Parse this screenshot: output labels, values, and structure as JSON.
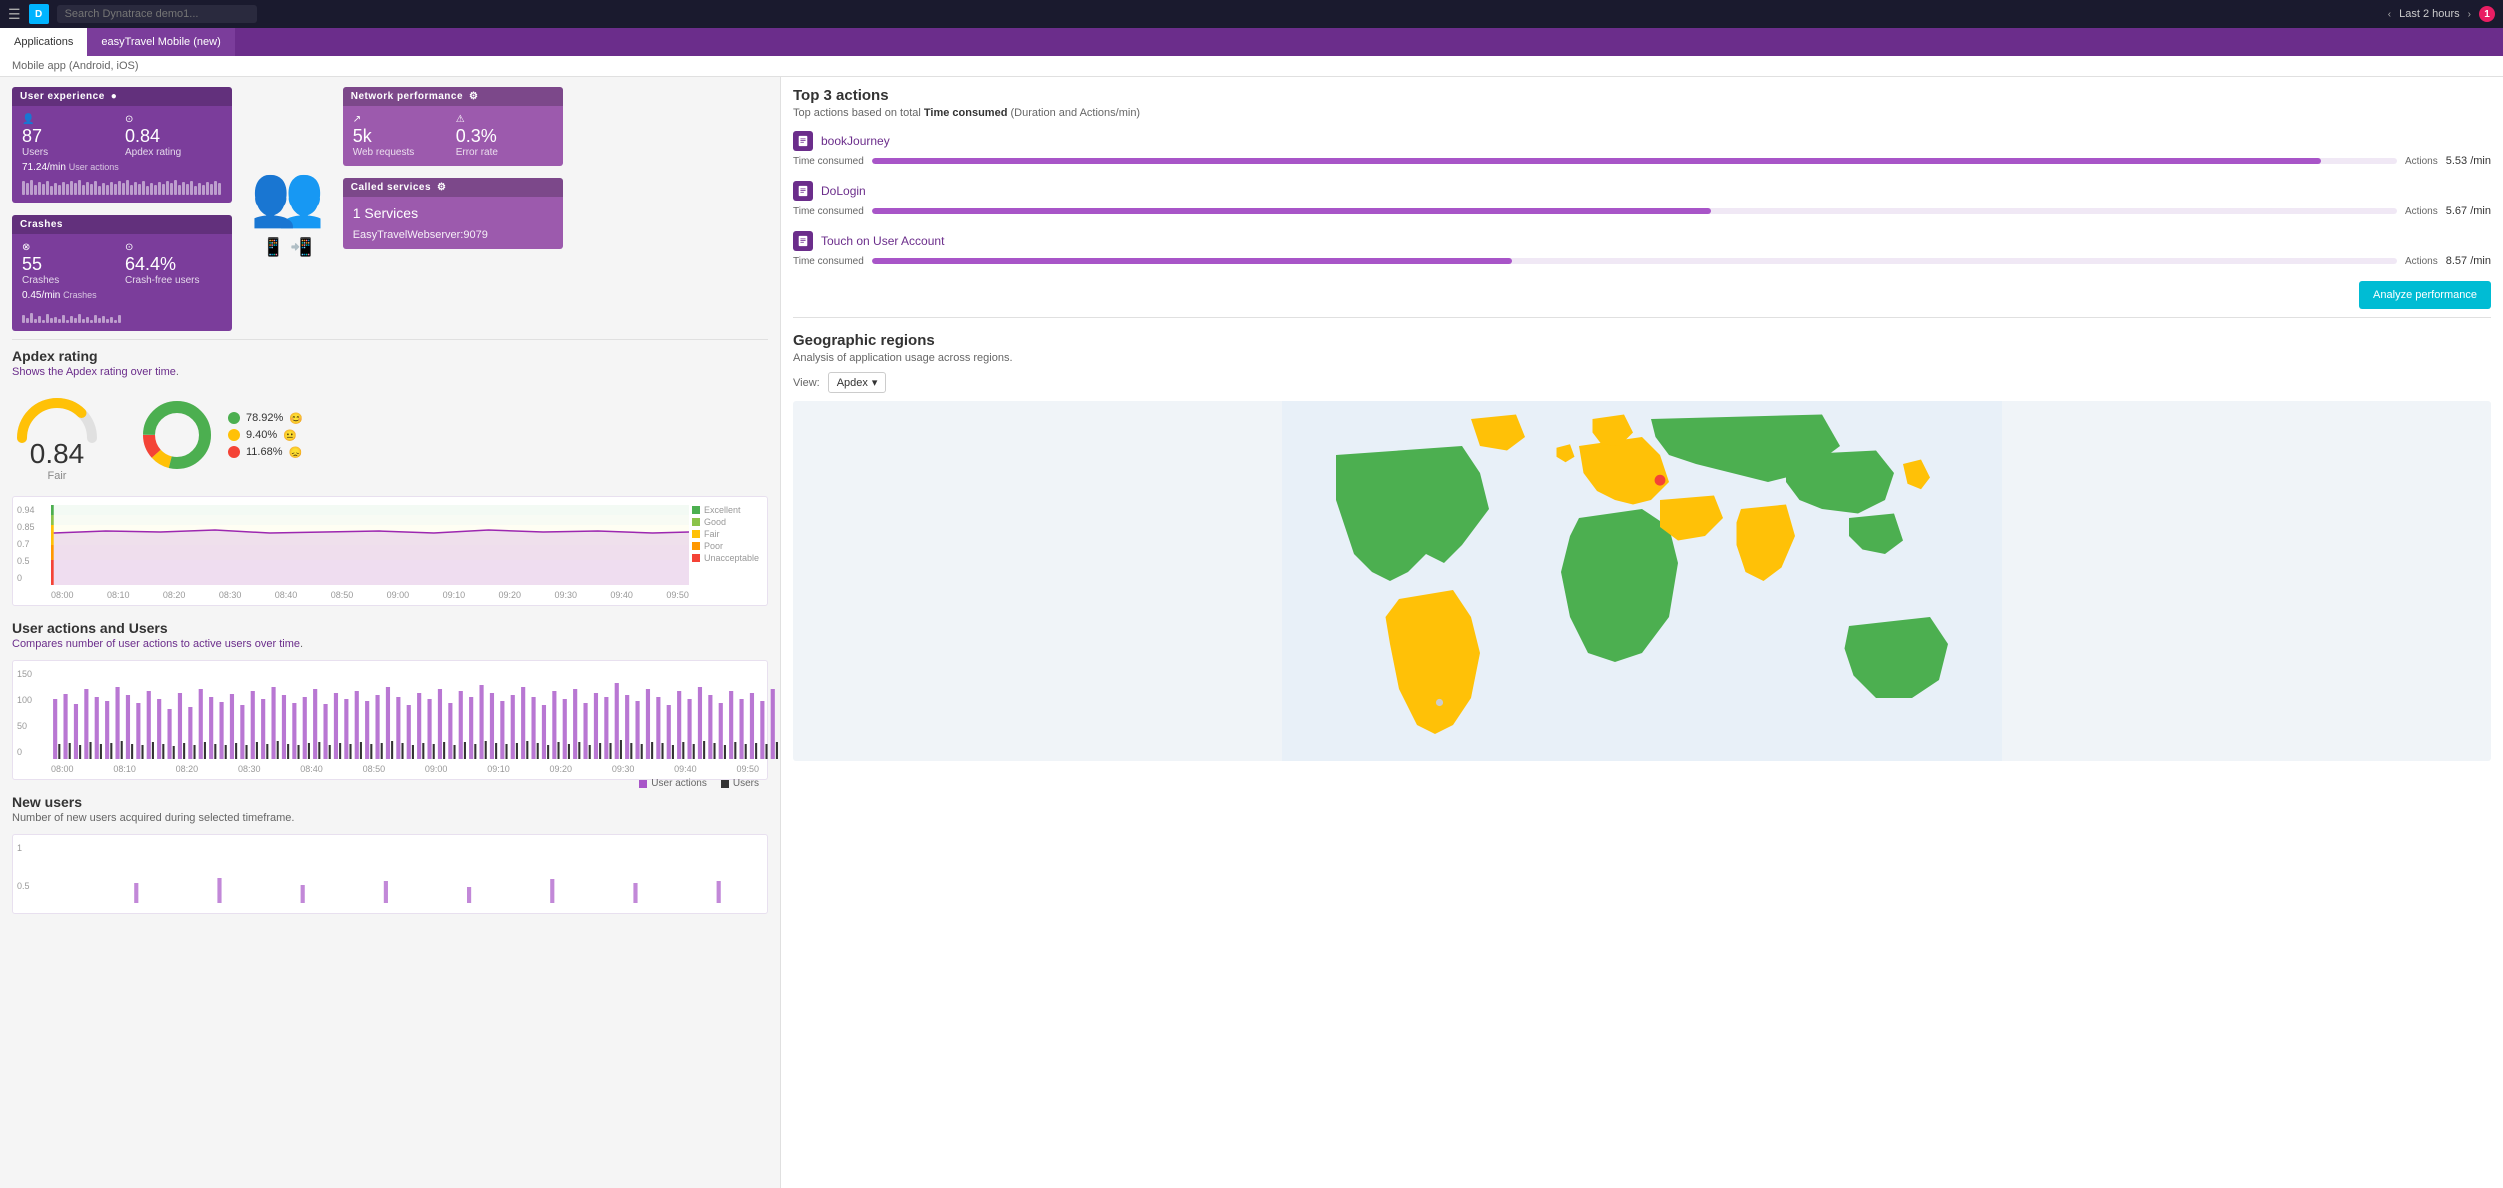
{
  "topnav": {
    "search_placeholder": "Search Dynatrace demo1...",
    "last_hours": "Last 2 hours",
    "notification_count": "1"
  },
  "tabs": [
    {
      "label": "Applications",
      "active": true
    },
    {
      "label": "easyTravel Mobile (new)",
      "active": false
    }
  ],
  "breadcrumb": "Mobile app (Android, iOS)",
  "overview": {
    "user_experience": {
      "title": "User experience",
      "users_value": "87",
      "users_label": "Users",
      "apdex_value": "0.84",
      "apdex_label": "Apdex rating",
      "actions_rate": "71.24/min",
      "actions_label": "User actions"
    },
    "crashes": {
      "title": "Crashes",
      "crashes_value": "55",
      "crashes_label": "Crashes",
      "crash_free_value": "64.4%",
      "crash_free_label": "Crash-free users",
      "crashes_rate": "0.45/min",
      "crashes_rate_label": "Crashes"
    },
    "network": {
      "title": "Network performance",
      "requests_value": "5k",
      "requests_label": "Web requests",
      "error_rate_value": "0.3%",
      "error_rate_label": "Error rate"
    },
    "services": {
      "title": "Called services",
      "services_value": "1 Services",
      "service_name": "EasyTravelWebserver:9079"
    }
  },
  "apdex": {
    "title": "Apdex rating",
    "subtitle": "Shows the Apdex rating over",
    "subtitle_link": "time",
    "gauge_value": "0.84",
    "gauge_label": "Fair",
    "excellent_pct": "78.92%",
    "good_pct": "9.40%",
    "poor_pct": "11.68%",
    "chart_y_labels": [
      "0.94",
      "0.85",
      "0.7",
      "0.5",
      "0"
    ],
    "chart_x_labels": [
      "08:00",
      "08:10",
      "08:20",
      "08:30",
      "08:40",
      "08:50",
      "09:00",
      "09:10",
      "09:20",
      "09:30",
      "09:40",
      "09:50"
    ],
    "legend": [
      {
        "label": "Excellent",
        "color": "#4caf50"
      },
      {
        "label": "Good",
        "color": "#8bc34a"
      },
      {
        "label": "Fair",
        "color": "#ffc107"
      },
      {
        "label": "Poor",
        "color": "#ff9800"
      },
      {
        "label": "Unacceptable",
        "color": "#f44336"
      }
    ]
  },
  "user_actions": {
    "title": "User actions and Users",
    "subtitle": "Compares number of user actions to active users",
    "subtitle_link": "over time",
    "y_labels": [
      "150",
      "100",
      "50",
      "0"
    ],
    "x_labels": [
      "08:00",
      "08:10",
      "08:20",
      "08:30",
      "08:40",
      "08:50",
      "09:00",
      "09:10",
      "09:20",
      "09:30",
      "09:40",
      "09:50"
    ],
    "legend": [
      {
        "label": "User actions",
        "color": "#a855c8"
      },
      {
        "label": "Users",
        "color": "#333"
      }
    ]
  },
  "new_users": {
    "title": "New users",
    "subtitle": "Number of new users acquired during selected timeframe.",
    "y_labels": [
      "1",
      "0.5"
    ]
  },
  "top3": {
    "title": "Top 3 actions",
    "subtitle": "Top actions based on total",
    "subtitle_bold": "Time consumed",
    "subtitle_end": "(Duration and Actions/min)",
    "actions": [
      {
        "name": "bookJourney",
        "bar_width": "95",
        "actions_value": "5.53 /min",
        "actions_label": "Actions",
        "time_label": "Time consumed"
      },
      {
        "name": "DoLogin",
        "bar_width": "55",
        "actions_value": "5.67 /min",
        "actions_label": "Actions",
        "time_label": "Time consumed"
      },
      {
        "name": "Touch on User Account",
        "bar_width": "42",
        "actions_value": "8.57 /min",
        "actions_label": "Actions",
        "time_label": "Time consumed"
      }
    ],
    "analyze_btn": "Analyze performance"
  },
  "geo": {
    "title": "Geographic regions",
    "subtitle": "Analysis of application usage across regions.",
    "view_label": "View:",
    "dropdown_label": "Apdex",
    "colors": {
      "green": "#4caf50",
      "yellow": "#ffc107",
      "gray": "#ccc",
      "red": "#f44336"
    }
  }
}
